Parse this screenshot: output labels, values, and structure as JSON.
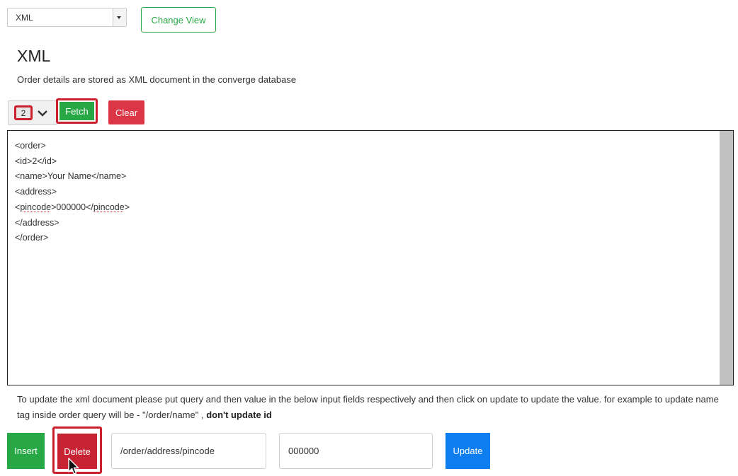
{
  "view_selector": {
    "selected": "XML"
  },
  "change_view_label": "Change View",
  "section": {
    "title": "XML",
    "description": "Order details are stored as XML document in the converge database"
  },
  "fetch_row": {
    "id_selected": "2",
    "fetch_label": "Fetch",
    "clear_label": "Clear"
  },
  "xml_document": {
    "lines": [
      "<order>",
      "<id>2</id>",
      "<name>Your Name</name>",
      "<address>",
      "<pincode>000000</pincode>",
      "</address>",
      "</order>"
    ],
    "spell_marked_word": "pincode"
  },
  "help": {
    "text": "To update the xml document please put query and then value in the below input fields respectively and then click on update to update the value. for example to update name tag inside order query will be - \"/order/name\" ,",
    "bold": "don't update id"
  },
  "actions": {
    "insert_label": "Insert",
    "delete_label": "Delete",
    "update_label": "Update"
  },
  "inputs": {
    "query_value": "/order/address/pincode",
    "value_value": "000000"
  },
  "colors": {
    "green": "#28a745",
    "red": "#dc3545",
    "highlight_red": "#cc1f2d",
    "blue": "#0d7df0"
  }
}
